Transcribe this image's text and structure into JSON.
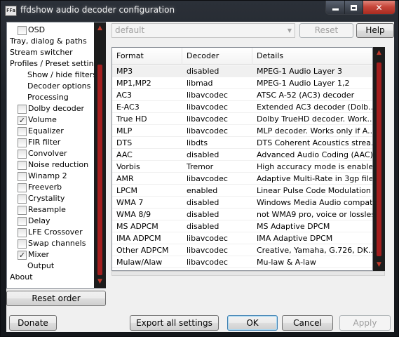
{
  "window": {
    "title": "ffdshow audio decoder configuration",
    "icon_text": "FFa"
  },
  "sidebar": {
    "items": [
      {
        "label": "OSD",
        "checkbox": true,
        "checked": false,
        "indent": 1
      },
      {
        "label": "Tray, dialog & paths",
        "checkbox": false,
        "indent": 0
      },
      {
        "label": "Stream switcher",
        "checkbox": false,
        "indent": 0
      },
      {
        "label": "Profiles / Preset settings",
        "checkbox": false,
        "indent": 0
      },
      {
        "label": "Show / hide filters",
        "checkbox": false,
        "indent": 2
      },
      {
        "label": "Decoder options",
        "checkbox": false,
        "indent": 2
      },
      {
        "label": "Processing",
        "checkbox": false,
        "indent": 2
      },
      {
        "label": "Dolby decoder",
        "checkbox": true,
        "checked": false,
        "indent": 1
      },
      {
        "label": "Volume",
        "checkbox": true,
        "checked": true,
        "indent": 1
      },
      {
        "label": "Equalizer",
        "checkbox": true,
        "checked": false,
        "indent": 1
      },
      {
        "label": "FIR filter",
        "checkbox": true,
        "checked": false,
        "indent": 1
      },
      {
        "label": "Convolver",
        "checkbox": true,
        "checked": false,
        "indent": 1
      },
      {
        "label": "Noise reduction",
        "checkbox": true,
        "checked": false,
        "indent": 1
      },
      {
        "label": "Winamp 2",
        "checkbox": true,
        "checked": false,
        "indent": 1
      },
      {
        "label": "Freeverb",
        "checkbox": true,
        "checked": false,
        "indent": 1
      },
      {
        "label": "Crystality",
        "checkbox": true,
        "checked": false,
        "indent": 1
      },
      {
        "label": "Resample",
        "checkbox": true,
        "checked": false,
        "indent": 1
      },
      {
        "label": "Delay",
        "checkbox": true,
        "checked": false,
        "indent": 1
      },
      {
        "label": "LFE Crossover",
        "checkbox": true,
        "checked": false,
        "indent": 1
      },
      {
        "label": "Swap channels",
        "checkbox": true,
        "checked": false,
        "indent": 1
      },
      {
        "label": "Mixer",
        "checkbox": true,
        "checked": true,
        "indent": 1
      },
      {
        "label": "Output",
        "checkbox": false,
        "indent": 2
      },
      {
        "label": "About",
        "checkbox": false,
        "indent": 0
      }
    ],
    "reset_order_label": "Reset order"
  },
  "preset": {
    "value": "default",
    "reset_label": "Reset",
    "help_label": "Help"
  },
  "codec_list": {
    "columns": [
      "Format",
      "Decoder",
      "Details"
    ],
    "rows": [
      [
        "MP3",
        "disabled",
        "MPEG-1 Audio Layer 3"
      ],
      [
        "MP1,MP2",
        "libmad",
        "MPEG-1 Audio Layer 1,2"
      ],
      [
        "AC3",
        "libavcodec",
        "ATSC A-52 (AC3) decoder"
      ],
      [
        "E-AC3",
        "libavcodec",
        "Extended AC3 decoder (Dolb..."
      ],
      [
        "True HD",
        "libavcodec",
        "Dolby TrueHD decoder. Work..."
      ],
      [
        "MLP",
        "libavcodec",
        "MLP decoder. Works only if A..."
      ],
      [
        "DTS",
        "libdts",
        "DTS Coherent Acoustics strea..."
      ],
      [
        "AAC",
        "disabled",
        "Advanced Audio Coding (AAC)"
      ],
      [
        "Vorbis",
        "Tremor",
        "High accuracy mode is enable..."
      ],
      [
        "AMR",
        "libavcodec",
        "Adaptive Multi-Rate in 3gp file..."
      ],
      [
        "LPCM",
        "enabled",
        "Linear Pulse Code Modulation"
      ],
      [
        "WMA 7",
        "disabled",
        "Windows Media Audio compati..."
      ],
      [
        "WMA 8/9",
        "disabled",
        "not WMA9 pro, voice or lossless"
      ],
      [
        "MS ADPCM",
        "disabled",
        "MS Adaptive DPCM"
      ],
      [
        "IMA ADPCM",
        "libavcodec",
        "IMA Adaptive DPCM"
      ],
      [
        "Other ADPCM",
        "libavcodec",
        "Creative, Yamaha, G.726, DK..."
      ],
      [
        "Mulaw/Alaw",
        "libavcodec",
        "Mu-law & A-law"
      ]
    ],
    "selected_row": 0
  },
  "footer": {
    "donate_label": "Donate",
    "export_label": "Export all settings",
    "ok_label": "OK",
    "cancel_label": "Cancel",
    "apply_label": "Apply"
  },
  "colors": {
    "scroll_accent": "#a31e1e",
    "scroll_track": "#1c1c1c",
    "selected_row": "#f0f0f0"
  }
}
